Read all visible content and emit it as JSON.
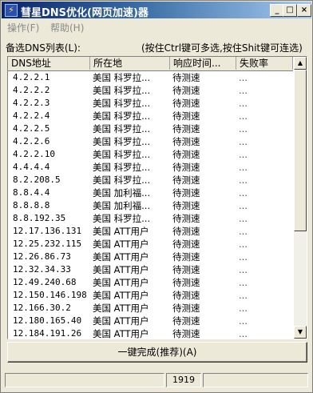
{
  "window": {
    "title": "彗星DNS优化(网页加速)器",
    "app_icon_glyph": "⚡",
    "controls": {
      "minimize": "_",
      "maximize": "□",
      "close": "×"
    }
  },
  "menu": [
    {
      "label": "操作(F)"
    },
    {
      "label": "帮助(H)"
    }
  ],
  "list_label": "备选DNS列表(L):",
  "hint": "(按住Ctrl键可多选,按住Shit键可连选)",
  "columns": [
    "DNS地址",
    "所在地",
    "响应时间...",
    "失败率"
  ],
  "rows": [
    {
      "ip": "4.2.2.1",
      "loc": "美国 科罗拉...",
      "resp": "待测速",
      "fail": "..."
    },
    {
      "ip": "4.2.2.2",
      "loc": "美国 科罗拉...",
      "resp": "待测速",
      "fail": "..."
    },
    {
      "ip": "4.2.2.3",
      "loc": "美国 科罗拉...",
      "resp": "待测速",
      "fail": "..."
    },
    {
      "ip": "4.2.2.4",
      "loc": "美国 科罗拉...",
      "resp": "待测速",
      "fail": "..."
    },
    {
      "ip": "4.2.2.5",
      "loc": "美国 科罗拉...",
      "resp": "待测速",
      "fail": "..."
    },
    {
      "ip": "4.2.2.6",
      "loc": "美国 科罗拉...",
      "resp": "待测速",
      "fail": "..."
    },
    {
      "ip": "4.2.2.10",
      "loc": "美国 科罗拉...",
      "resp": "待测速",
      "fail": "..."
    },
    {
      "ip": "4.4.4.4",
      "loc": "美国 科罗拉...",
      "resp": "待测速",
      "fail": "..."
    },
    {
      "ip": "8.2.208.5",
      "loc": "美国 科罗拉...",
      "resp": "待测速",
      "fail": "..."
    },
    {
      "ip": "8.8.4.4",
      "loc": "美国 加利福...",
      "resp": "待测速",
      "fail": "..."
    },
    {
      "ip": "8.8.8.8",
      "loc": "美国 加利福...",
      "resp": "待测速",
      "fail": "..."
    },
    {
      "ip": "8.8.192.35",
      "loc": "美国 科罗拉...",
      "resp": "待测速",
      "fail": "..."
    },
    {
      "ip": "12.17.136.131",
      "loc": "美国 ATT用户",
      "resp": "待测速",
      "fail": "..."
    },
    {
      "ip": "12.25.232.115",
      "loc": "美国 ATT用户",
      "resp": "待测速",
      "fail": "..."
    },
    {
      "ip": "12.26.86.73",
      "loc": "美国 ATT用户",
      "resp": "待测速",
      "fail": "..."
    },
    {
      "ip": "12.32.34.33",
      "loc": "美国 ATT用户",
      "resp": "待测速",
      "fail": "..."
    },
    {
      "ip": "12.49.240.68",
      "loc": "美国 ATT用户",
      "resp": "待测速",
      "fail": "..."
    },
    {
      "ip": "12.150.146.198",
      "loc": "美国 ATT用户",
      "resp": "待测速",
      "fail": "..."
    },
    {
      "ip": "12.166.30.2",
      "loc": "美国 ATT用户",
      "resp": "待测速",
      "fail": "..."
    },
    {
      "ip": "12.180.165.40",
      "loc": "美国 ATT用户",
      "resp": "待测速",
      "fail": "..."
    },
    {
      "ip": "12.184.191.26",
      "loc": "美国 ATT用户",
      "resp": "待测速",
      "fail": "..."
    }
  ],
  "action_button": "一键完成(推荐)(A)",
  "status": {
    "count": "1919"
  }
}
